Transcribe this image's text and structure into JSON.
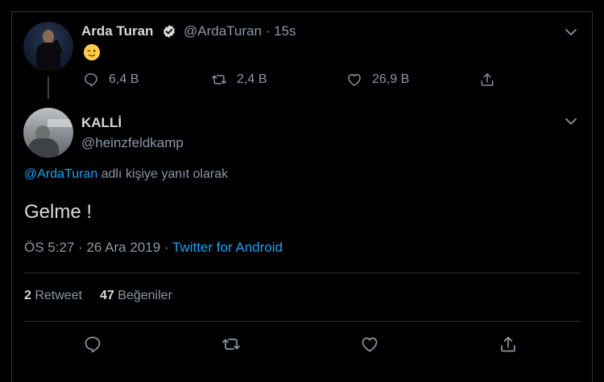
{
  "parent_tweet": {
    "author_name": "Arda Turan",
    "handle": "@ArdaTuran",
    "time_sep": "·",
    "time": "15s",
    "actions": {
      "reply_count": "6,4 B",
      "retweet_count": "2,4 B",
      "like_count": "26,9 B"
    }
  },
  "reply_tweet": {
    "author_name": "KALLİ",
    "handle": "@heinzfeldkamp",
    "reply_to_link": "@ArdaTuran",
    "reply_to_suffix": " adlı kişiye yanıt olarak",
    "text": "Gelme !",
    "timestamp": "ÖS 5:27 · 26 Ara 2019",
    "meta_sep": " · ",
    "source": "Twitter for Android"
  },
  "stats": {
    "retweet_count": "2",
    "retweet_label": " Retweet",
    "like_count": "47",
    "like_label": " Beğeniler"
  },
  "colors": {
    "background": "#000000",
    "link": "#1da1f2",
    "muted": "#8b98a5",
    "border": "#2f3336"
  }
}
